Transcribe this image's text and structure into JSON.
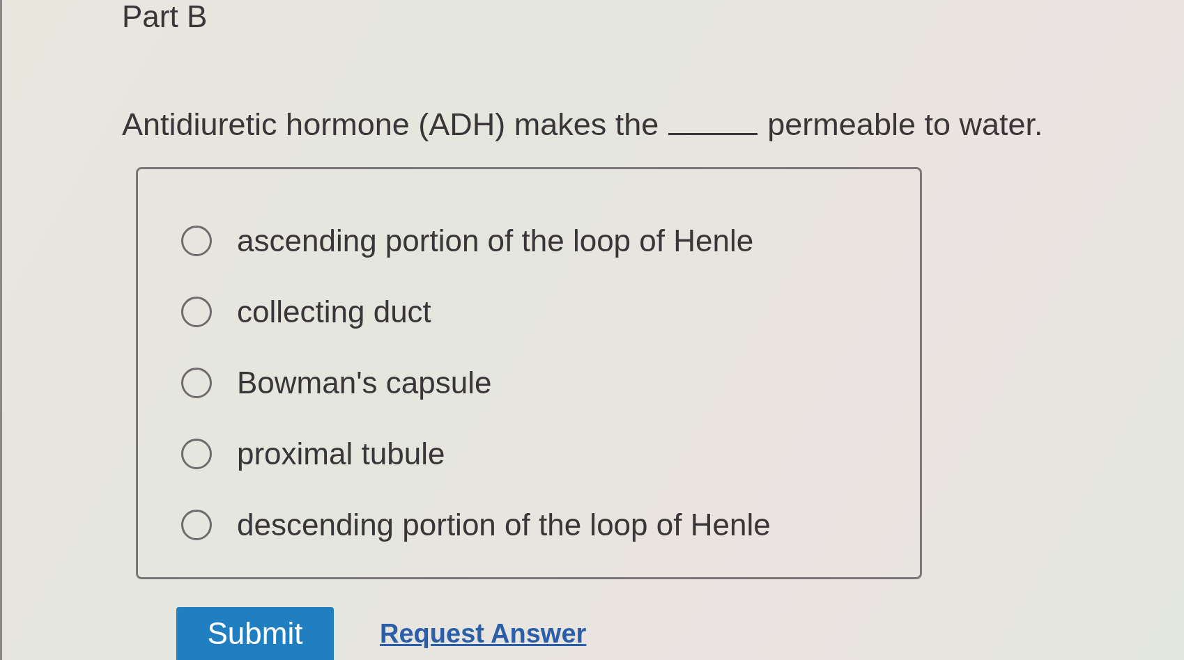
{
  "part_title": "Part B",
  "question": {
    "before": "Antidiuretic hormone (ADH) makes the",
    "after": "permeable to water."
  },
  "options": [
    {
      "label": "ascending portion of the loop of Henle",
      "selected": false
    },
    {
      "label": "collecting duct",
      "selected": false
    },
    {
      "label": "Bowman's capsule",
      "selected": false
    },
    {
      "label": "proximal tubule",
      "selected": false
    },
    {
      "label": "descending portion of the loop of Henle",
      "selected": false
    }
  ],
  "actions": {
    "submit": "Submit",
    "request_answer": "Request Answer"
  }
}
